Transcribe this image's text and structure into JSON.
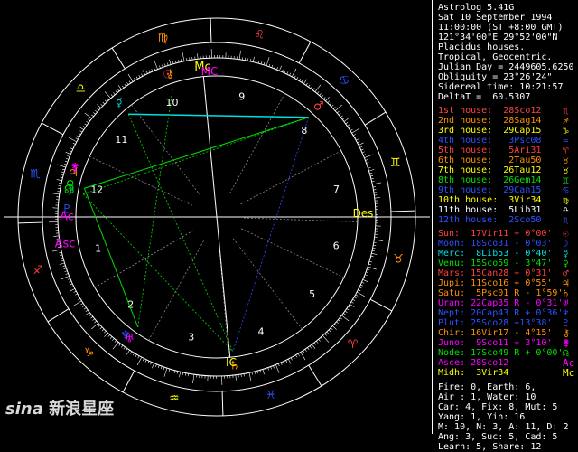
{
  "header": [
    "Astrolog 5.41G",
    "Sat 10 September 1994",
    "11:00:00 (ST +8:00 GMT)",
    "121°34'00\"E 29°52'00\"N",
    "Placidus houses.",
    "Tropical, Geocentric.",
    "Julian Day = 2449605.6250",
    "Obliquity = 23°26'24\"",
    "Sidereal time: 10:21:57",
    "DeltaT =  60.5307"
  ],
  "houses": [
    {
      "label": "1st house:",
      "value": "28Sco12",
      "color": "#ff4040",
      "glyph": "♏"
    },
    {
      "label": "2nd house:",
      "value": "28Sag14",
      "color": "#ff9000",
      "glyph": "♐"
    },
    {
      "label": "3rd house:",
      "value": "29Cap15",
      "color": "#ffff00",
      "glyph": "♑"
    },
    {
      "label": "4th house:",
      "value": "3Psc08",
      "color": "#3050ff",
      "glyph": "♒"
    },
    {
      "label": "5th house:",
      "value": "5Ari31",
      "color": "#ff4040",
      "glyph": "♈"
    },
    {
      "label": "6th house:",
      "value": "2Tau50",
      "color": "#ff9000",
      "glyph": "♉"
    },
    {
      "label": "7th house:",
      "value": "26Tau12",
      "color": "#ffff00",
      "glyph": "♉"
    },
    {
      "label": "8th house:",
      "value": "26Gem14",
      "color": "#00e000",
      "glyph": "♊"
    },
    {
      "label": "9th house:",
      "value": "29Can15",
      "color": "#3050ff",
      "glyph": "♋"
    },
    {
      "label": "10th house:",
      "value": "3Vir34",
      "color": "#ffff00",
      "glyph": "♍"
    },
    {
      "label": "11th house:",
      "value": "5Lib31",
      "color": "#ffffff",
      "glyph": "♎"
    },
    {
      "label": "12th house:",
      "value": "2Sco50",
      "color": "#3050ff",
      "glyph": "♏"
    }
  ],
  "planets": [
    {
      "label": "Sun:",
      "pos": "17Vir11",
      "speed": "+ 0°00'",
      "color": "#ff4040",
      "glyph": "☉"
    },
    {
      "label": "Moon:",
      "pos": "18Sco31",
      "speed": "- 0°03'",
      "color": "#3050ff",
      "glyph": "☽"
    },
    {
      "label": "Merc:",
      "pos": "8Lib53",
      "speed": "- 0°40'",
      "color": "#00e0e0",
      "glyph": "☿"
    },
    {
      "label": "Venu:",
      "pos": "15Sco59",
      "speed": "- 3°47'",
      "color": "#00e000",
      "glyph": "♀"
    },
    {
      "label": "Mars:",
      "pos": "15Can28",
      "speed": "+ 0°31'",
      "color": "#ff4040",
      "glyph": "♂"
    },
    {
      "label": "Jupi:",
      "pos": "11Sco16",
      "speed": "+ 0°55'",
      "color": "#ff9000",
      "glyph": "♃"
    },
    {
      "label": "Satu:",
      "pos": "5Psc01",
      "speed": "R - 1°59'",
      "color": "#ff9000",
      "glyph": "♄"
    },
    {
      "label": "Uran:",
      "pos": "22Cap35",
      "speed": "R - 0°31'",
      "color": "#ff00ff",
      "glyph": "♅"
    },
    {
      "label": "Nept:",
      "pos": "20Cap43",
      "speed": "R + 0°36'",
      "color": "#3050ff",
      "glyph": "♆"
    },
    {
      "label": "Plut:",
      "pos": "25Sco28",
      "speed": "+13°38'",
      "color": "#3050ff",
      "glyph": "♇"
    },
    {
      "label": "Chir:",
      "pos": "16Vir17",
      "speed": "- 4°15'",
      "color": "#ff9000",
      "glyph": "⚷"
    },
    {
      "label": "Juno:",
      "pos": "9Sco11",
      "speed": "+ 3°10'",
      "color": "#ff00ff",
      "glyph": "⚵"
    },
    {
      "label": "Node:",
      "pos": "17Sco49",
      "speed": "R + 0°00'",
      "color": "#00e000",
      "glyph": "☊"
    },
    {
      "label": "Asce:",
      "pos": "28Sco12",
      "speed": "",
      "color": "#ff00ff",
      "glyph": "Ac"
    },
    {
      "label": "Midh:",
      "pos": "3Vir34",
      "speed": "",
      "color": "#ffff00",
      "glyph": "Mc"
    }
  ],
  "summary": [
    "Fire: 0, Earth: 6,",
    "Air : 1, Water: 10",
    "Car: 4, Fix: 8, Mut: 5",
    "Yang: 1, Yin: 16",
    "M: 10, N: 3, A: 11, D: 2",
    "Ang: 3, Suc: 5, Cad: 5",
    "Learn: 5, Share: 12"
  ],
  "wheel": {
    "signs": [
      {
        "name": "aries-icon",
        "glyph": "♈",
        "color": "#ff4040",
        "lon": 15
      },
      {
        "name": "taurus-icon",
        "glyph": "♉",
        "color": "#ff9000",
        "lon": 45
      },
      {
        "name": "gemini-icon",
        "glyph": "♊",
        "color": "#ffff00",
        "lon": 75
      },
      {
        "name": "cancer-icon",
        "glyph": "♋",
        "color": "#3050ff",
        "lon": 105
      },
      {
        "name": "leo-icon",
        "glyph": "♌",
        "color": "#ff4040",
        "lon": 135
      },
      {
        "name": "virgo-icon",
        "glyph": "♍",
        "color": "#ff9000",
        "lon": 165
      },
      {
        "name": "libra-icon",
        "glyph": "♎",
        "color": "#ffff00",
        "lon": 195
      },
      {
        "name": "scorpio-icon",
        "glyph": "♏",
        "color": "#3050ff",
        "lon": 225
      },
      {
        "name": "sagittarius-icon",
        "glyph": "♐",
        "color": "#ff4040",
        "lon": 255
      },
      {
        "name": "capricorn-icon",
        "glyph": "♑",
        "color": "#ff9000",
        "lon": 285
      },
      {
        "name": "aquarius-icon",
        "glyph": "♒",
        "color": "#ffff00",
        "lon": 315
      },
      {
        "name": "pisces-icon",
        "glyph": "♓",
        "color": "#3050ff",
        "lon": 345
      }
    ],
    "asc_label": "Asc",
    "mc_label": "MC",
    "des_label": "Des",
    "ic_label": "IC",
    "house_numbers": [
      "1",
      "2",
      "3",
      "4",
      "5",
      "6",
      "7",
      "8",
      "9",
      "10",
      "11",
      "12"
    ]
  },
  "watermark": {
    "brand": "sina",
    "text": "新浪星座"
  }
}
